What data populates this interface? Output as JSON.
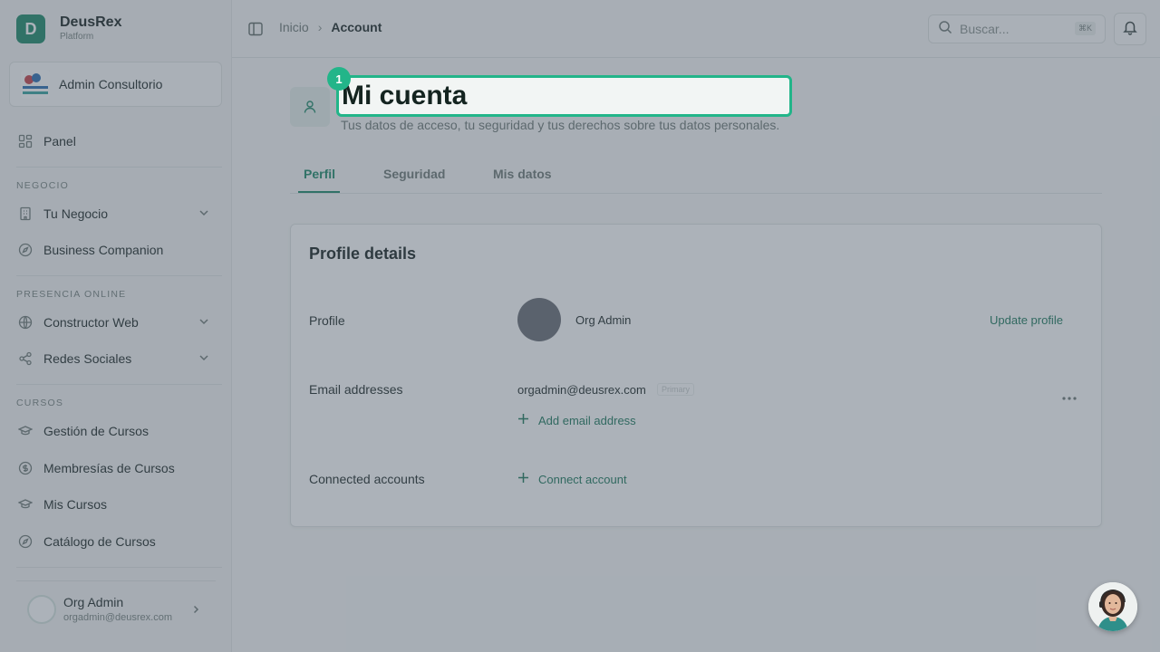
{
  "brand": {
    "initial": "D",
    "name": "DeusRex",
    "subtitle": "Platform"
  },
  "organization": {
    "name": "Admin Consultorio"
  },
  "sidebar": {
    "panel": "Panel",
    "sections": [
      {
        "label": "NEGOCIO",
        "items": [
          {
            "label": "Tu Negocio",
            "icon": "building-icon",
            "expandable": true
          },
          {
            "label": "Business Companion",
            "icon": "compass-icon",
            "expandable": false
          }
        ]
      },
      {
        "label": "PRESENCIA ONLINE",
        "items": [
          {
            "label": "Constructor Web",
            "icon": "globe-icon",
            "expandable": true
          },
          {
            "label": "Redes Sociales",
            "icon": "share-icon",
            "expandable": true
          }
        ]
      },
      {
        "label": "CURSOS",
        "items": [
          {
            "label": "Gestión de Cursos",
            "icon": "graduation-cap-icon"
          },
          {
            "label": "Membresías de Cursos",
            "icon": "dollar-circle-icon"
          },
          {
            "label": "Mis Cursos",
            "icon": "graduation-cap-icon"
          },
          {
            "label": "Catálogo de Cursos",
            "icon": "compass-icon"
          }
        ]
      }
    ],
    "user": {
      "name": "Org Admin",
      "email": "orgadmin@deusrex.com"
    }
  },
  "header": {
    "breadcrumb": {
      "home": "Inicio",
      "separator": "›",
      "current": "Account"
    },
    "search": {
      "placeholder": "Buscar...",
      "shortcut": "⌘K"
    }
  },
  "page": {
    "step_number": "1",
    "title": "Mi cuenta",
    "subtitle": "Tus datos de acceso, tu seguridad y tus derechos sobre tus datos personales.",
    "tabs": [
      {
        "label": "Perfil",
        "active": true
      },
      {
        "label": "Seguridad",
        "active": false
      },
      {
        "label": "Mis datos",
        "active": false
      }
    ]
  },
  "profile_card": {
    "title": "Profile details",
    "profile_label": "Profile",
    "profile_name": "Org Admin",
    "update_profile": "Update profile",
    "email_label": "Email addresses",
    "email": "orgadmin@deusrex.com",
    "email_badge": "Primary",
    "add_email": "Add email address",
    "connected_label": "Connected accounts",
    "connect_account": "Connect account"
  },
  "colors": {
    "accent": "#1f8a6a",
    "highlight": "#22b589",
    "overlay": "#465564"
  }
}
